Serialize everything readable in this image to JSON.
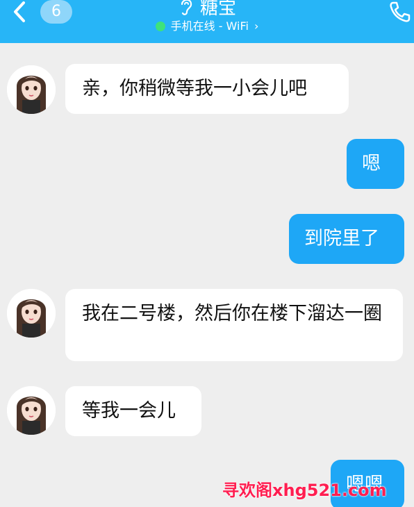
{
  "header": {
    "unread_count": "6",
    "contact_name": "糖宝",
    "status_text": "手机在线 - WiFi",
    "status_chevron": "›",
    "accent_color": "#27b5f7",
    "icons": [
      "back-arrow-icon",
      "hearing-ear-icon",
      "phone-icon",
      "online-dot-icon"
    ]
  },
  "messages": [
    {
      "direction": "in",
      "text": "亲，你稍微等我一小会儿吧"
    },
    {
      "direction": "out",
      "text": "嗯"
    },
    {
      "direction": "out",
      "text": "到院里了"
    },
    {
      "direction": "in",
      "text": "我在二号楼，然后你在楼下溜达一圈"
    },
    {
      "direction": "in",
      "text": "等我一会儿"
    },
    {
      "direction": "out",
      "text": "嗯嗯"
    }
  ],
  "watermark": "寻欢阁xhg521.com"
}
